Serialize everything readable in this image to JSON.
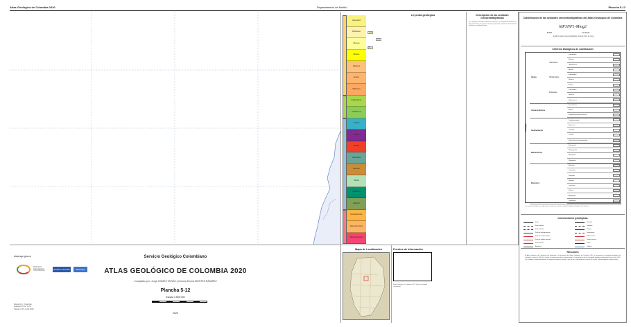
{
  "header": {
    "left": "Atlas Geológico de Colombia 2020",
    "center": "Departamento de Nariño",
    "right": "Plancha 5-12"
  },
  "map": {
    "ocean_color": "#ffffff",
    "land_color": "#e9eef8"
  },
  "title_block": {
    "url": "www.sgc.gov.co",
    "logo_sgc_text": "SERVICIO GEOLÓGICO COLOMBIANO",
    "logo_minenergia": "El futuro es de todos",
    "logo_gobierno": "Minenergía",
    "organization": "Servicio Geológico Colombiano",
    "title": "ATLAS GEOLÓGICO DE COLOMBIA 2020",
    "compiled_by": "Compilado por: Jorge GÓMEZ TAPIAS y Nohora Emma MONTES RAMÍREZ",
    "plate": "Plancha 5-12",
    "scale": "Escala 1:500 000",
    "year": "2020",
    "fine_print": "Bogotá D.C., Colombia\nDiagonal 53 No. 34-53\nTeléfono: (57) 1 220 0200"
  },
  "legend": {
    "title": "Leyenda geológica",
    "description_title": "Descripción de las unidades cronoestratigráficas",
    "description_text": "Q-ca Depósitos aluviales y de llanuras aluviales. Q-al Depósitos aluviales, de llanuras aluviales, de terrazas aluviales y depósitos coluviales. N1-VCc Rocas volcánicas y volcanoclásticas.",
    "strat_units": [
      {
        "label": "Cuaternario",
        "color": "#f9f27f"
      },
      {
        "label": "Pleistoceno",
        "color": "#fff2ae"
      },
      {
        "label": "Plioceno",
        "color": "#ffff99"
      },
      {
        "label": "Mioceno",
        "color": "#ffff00"
      },
      {
        "label": "Oligoceno",
        "color": "#fec07a"
      },
      {
        "label": "Eoceno",
        "color": "#fdb46c"
      },
      {
        "label": "Paleoceno",
        "color": "#fda75f"
      },
      {
        "label": "Cretácico Sup.",
        "color": "#a6d84a"
      },
      {
        "label": "Cretácico Inf.",
        "color": "#8ccd57"
      },
      {
        "label": "Jurásico",
        "color": "#34b2c9"
      },
      {
        "label": "Triásico",
        "color": "#812b92"
      },
      {
        "label": "Pérmico",
        "color": "#f04028"
      },
      {
        "label": "Carbonífero",
        "color": "#67a599"
      },
      {
        "label": "Devónico",
        "color": "#cb8c37"
      },
      {
        "label": "Silúrico",
        "color": "#b3e1b6"
      },
      {
        "label": "Ordovícico",
        "color": "#009270"
      },
      {
        "label": "Cámbrico",
        "color": "#7fa056"
      },
      {
        "label": "Neoproterozoico",
        "color": "#feb342"
      },
      {
        "label": "Mesoproterozoico",
        "color": "#fdb462"
      },
      {
        "label": "Paleoproterozoico",
        "color": "#f74370"
      }
    ],
    "unit_codes": [
      {
        "code": "Q-ca",
        "color": "#fff7c2"
      },
      {
        "code": "Q-al",
        "color": "#fff7c2"
      },
      {
        "code": "N1-VCc",
        "color": "#f7e08a"
      }
    ]
  },
  "location": {
    "title": "Mapa de Localización",
    "sources_title": "Fuentes de información",
    "sources_note": "Mapa Geológico de Colombia 2015, Servicio Geológico Colombiano."
  },
  "right_panel": {
    "classification_title": "Clasificación de las unidades cronoestratigráficas del Atlas Geológico de Colombia",
    "formula": "MP3NP1-Mmg2",
    "edad_label": "Edad",
    "lito_label": "Litología",
    "subtitle": "Edad (Unidad cronoestratigráfica)      Litología (Tipo de roca)",
    "criteria_title": "Criterios litológicos de codificación",
    "lithology_side": "Litología",
    "groups": [
      {
        "name": "Ígneas",
        "sub": [
          "Volcánicas",
          "Hipoabisales",
          "Plutónicas"
        ]
      },
      {
        "name": "Volcanoclásticas"
      },
      {
        "name": "Sedimentarias"
      },
      {
        "name": "Metamórficas"
      },
      {
        "name": "Depósitos"
      }
    ],
    "criteria_rows": [
      "Intermedias",
      "Básicas",
      "Ultrabásicas",
      "Ácidas",
      "Intermedias",
      "Básicas",
      "Ácidas",
      "Intermedias",
      "Básicas",
      "Ultrabásicas",
      "Piroclásticas",
      "Mixtas",
      "Sedimentarias/piroclásticas",
      "Conglomerados",
      "Areniscas",
      "Lodolitas",
      "Calizas",
      "Silicoclásticas/carbonatadas",
      "Bajo grado",
      "Medio grado",
      "Alto grado",
      "Migmatitas",
      "Aluviales",
      "Coluviales",
      "Glaciares",
      "Marinos",
      "Lacustres",
      "Eólicos",
      "Antrópicos",
      "Volcánicos"
    ],
    "criteria_note": "Los criterios litológicos de codificación se aplican a todas las unidades del Atlas Geológico de Colombia.",
    "conventions_title": "Convenciones geológicas",
    "conventions": [
      "Falla",
      "Falla inferida",
      "Falla cubierta",
      "Falla de cabalgamiento",
      "Falla de rumbo dextral",
      "Falla de rumbo sinestral",
      "Falla normal",
      "Anticlinal",
      "Sinclinal",
      "Contacto",
      "Pliegue",
      "Lineamiento",
      "Volcán activo",
      "Volcán inactivo",
      "Domo",
      "Caldera"
    ],
    "summary_title": "Resumen",
    "summary": "El Atlas Geológico de Colombia está elaborado a la dimensión del Mapa Geológico de Colombia 2015, y representa la cartografía geológica de Colombia a escala 1:500 000. Incluye la actualización de la nomenclatura y la información de la cartografía geológica disponible hasta el año 2020. Las unidades cronoestratigráficas se agruparon según la edad y el tipo de roca, siguiendo los criterios de la carta cronoestratigráfica internacional."
  }
}
